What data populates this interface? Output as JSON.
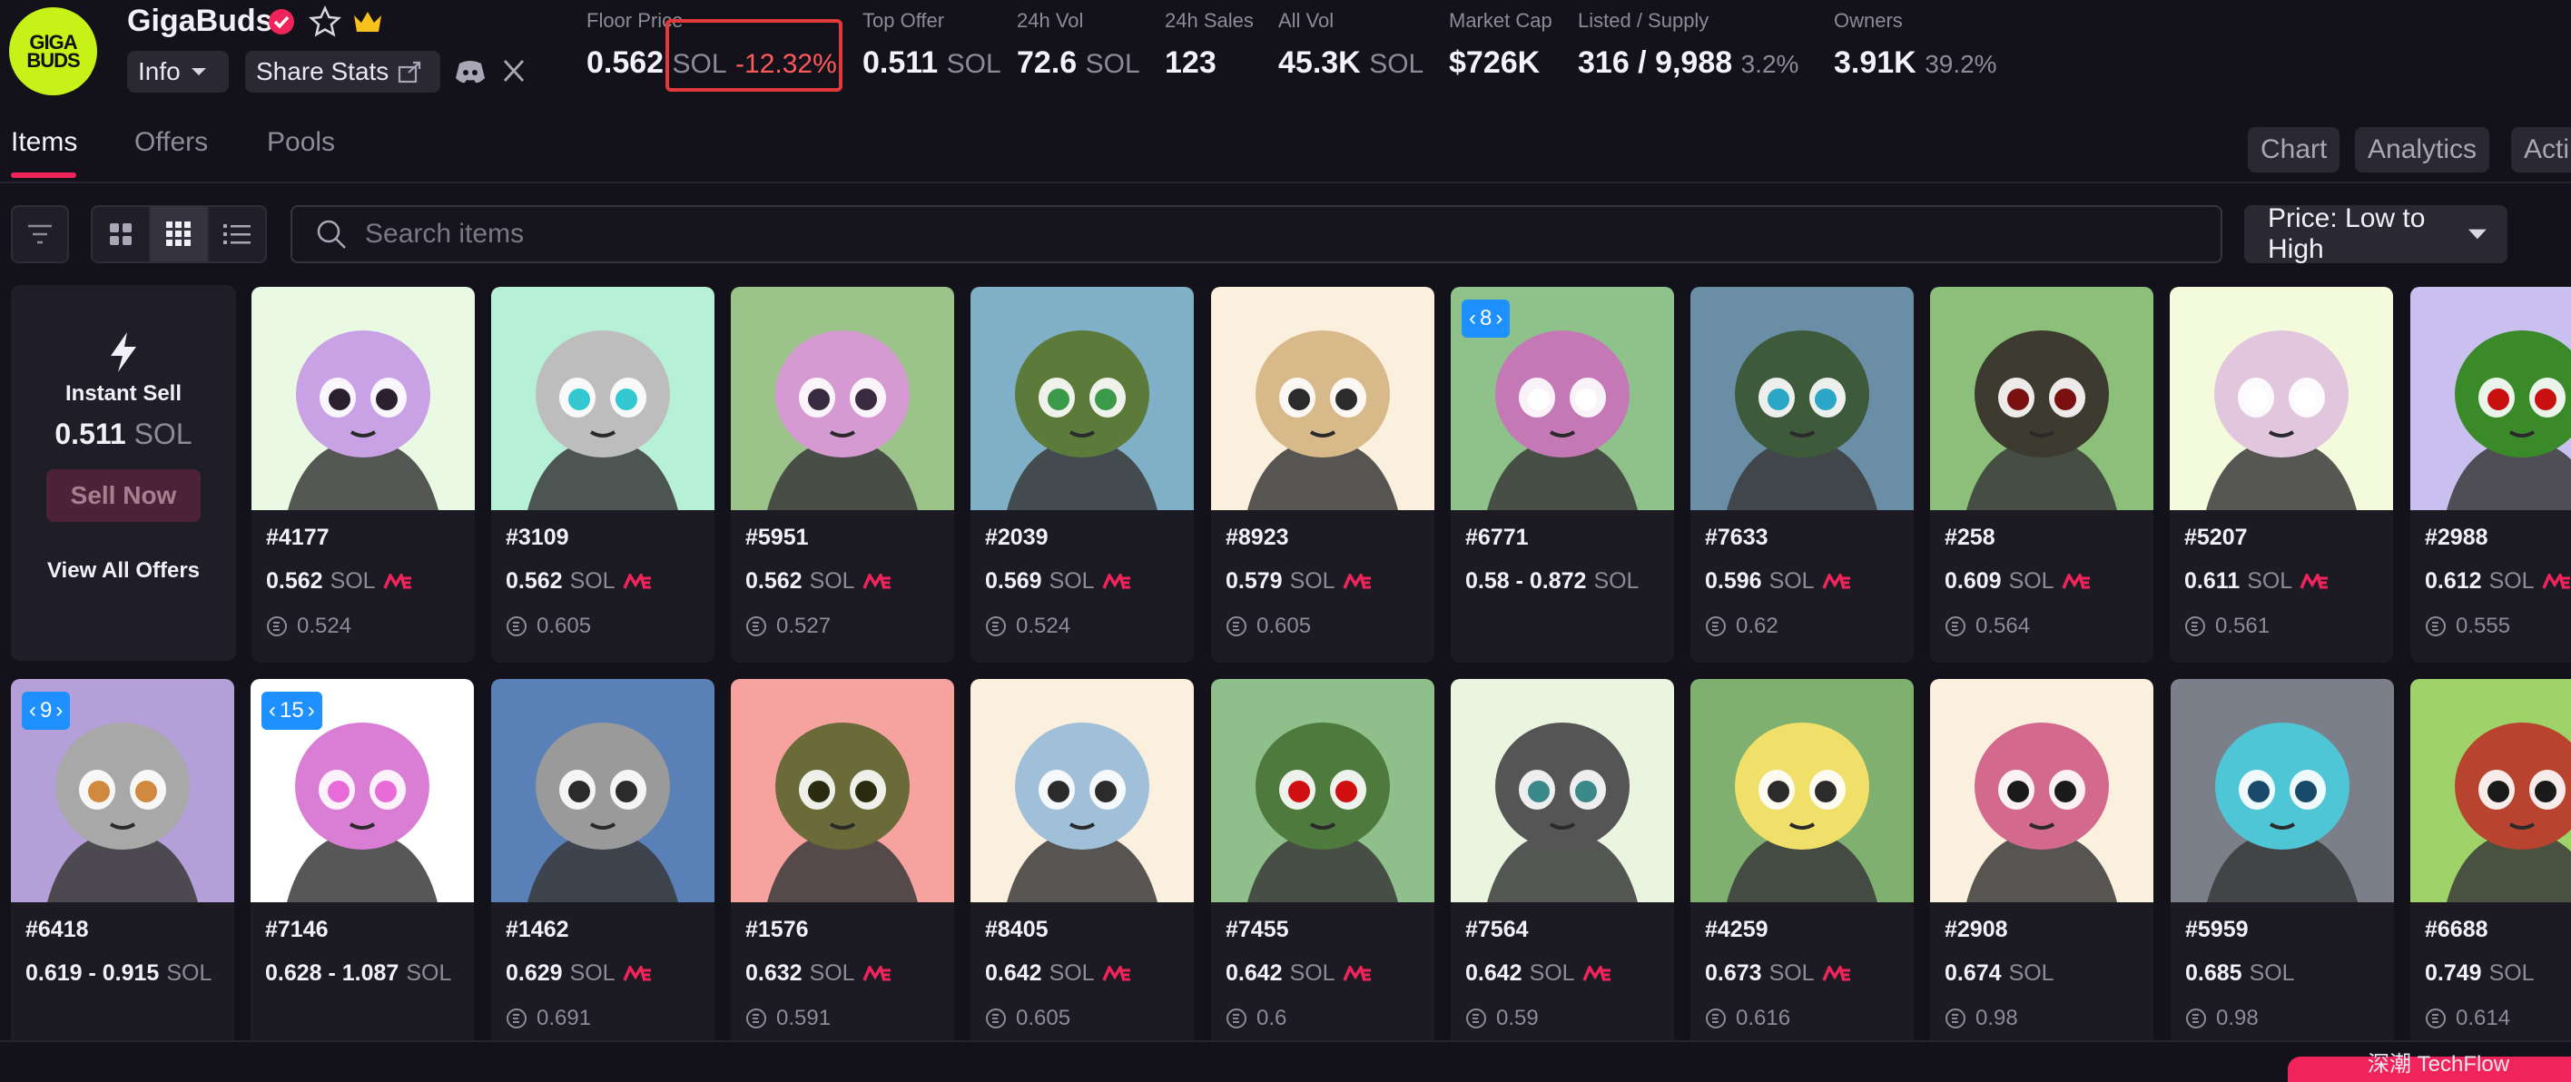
{
  "collection": {
    "name": "GigaBuds",
    "logo_text": "GIGA\nBUDS",
    "info_label": "Info",
    "share_label": "Share Stats"
  },
  "stats": [
    {
      "label": "Floor Price",
      "value": "0.562",
      "unit": "SOL",
      "change": "-12.32%"
    },
    {
      "label": "Top Offer",
      "value": "0.511",
      "unit": "SOL"
    },
    {
      "label": "24h Vol",
      "value": "72.6",
      "unit": "SOL"
    },
    {
      "label": "24h Sales",
      "value": "123"
    },
    {
      "label": "All Vol",
      "value": "45.3K",
      "unit": "SOL"
    },
    {
      "label": "Market Cap",
      "value": "$726K"
    },
    {
      "label": "Listed / Supply",
      "value": "316 / 9,988",
      "pct": "3.2%"
    },
    {
      "label": "Owners",
      "value": "3.91K",
      "pct": "39.2%"
    }
  ],
  "tabs": [
    {
      "label": "Items",
      "active": true
    },
    {
      "label": "Offers",
      "active": false
    },
    {
      "label": "Pools",
      "active": false
    }
  ],
  "right_tabs": [
    "Chart",
    "Analytics",
    "Acti"
  ],
  "search": {
    "placeholder": "Search items"
  },
  "sort": {
    "label": "Price: Low to High"
  },
  "instant_sell": {
    "title": "Instant Sell",
    "price": "0.511",
    "unit": "SOL",
    "button": "Sell Now",
    "link": "View All Offers"
  },
  "colors": {
    "accent": "#f0245b",
    "brand_logo": "#c6f218",
    "negative": "#ff5a5a",
    "badge": "#1e90ff"
  },
  "items": [
    {
      "id": "#4177",
      "price": "0.562",
      "unit": "SOL",
      "me": true,
      "last": "0.524",
      "badge": "",
      "bg": "#eaf9e4",
      "head": "#c9a2e6",
      "eye": "#2b2030"
    },
    {
      "id": "#3109",
      "price": "0.562",
      "unit": "SOL",
      "me": true,
      "last": "0.605",
      "badge": "",
      "bg": "#b6f0d6",
      "head": "#bdbdbd",
      "eye": "#33c7d1"
    },
    {
      "id": "#5951",
      "price": "0.562",
      "unit": "SOL",
      "me": true,
      "last": "0.527",
      "badge": "",
      "bg": "#9cc38a",
      "head": "#d49ad1",
      "eye": "#3a2b40"
    },
    {
      "id": "#2039",
      "price": "0.569",
      "unit": "SOL",
      "me": true,
      "last": "0.524",
      "badge": "",
      "bg": "#7fb0c8",
      "head": "#5c7a3a",
      "eye": "#3a9a4a"
    },
    {
      "id": "#8923",
      "price": "0.579",
      "unit": "SOL",
      "me": true,
      "last": "0.605",
      "badge": "",
      "bg": "#fbf0dd",
      "head": "#d8b98a",
      "eye": "#2b2b2b"
    },
    {
      "id": "#6771",
      "price": "0.58 - 0.872",
      "unit": "SOL",
      "me": false,
      "last": "",
      "badge": "8",
      "bg": "#8fc18a",
      "head": "#c479b6",
      "eye": "#ffffff"
    },
    {
      "id": "#7633",
      "price": "0.596",
      "unit": "SOL",
      "me": true,
      "last": "0.62",
      "badge": "",
      "bg": "#6a8ea6",
      "head": "#3d5a3a",
      "eye": "#2aa7c7"
    },
    {
      "id": "#258",
      "price": "0.609",
      "unit": "SOL",
      "me": true,
      "last": "0.564",
      "badge": "",
      "bg": "#8cbf7a",
      "head": "#3d3a30",
      "eye": "#7a1010"
    },
    {
      "id": "#5207",
      "price": "0.611",
      "unit": "SOL",
      "me": true,
      "last": "0.561",
      "badge": "",
      "bg": "#f4fbdc",
      "head": "#e2c6de",
      "eye": "#ffffff"
    },
    {
      "id": "#2988",
      "price": "0.612",
      "unit": "SOL",
      "me": true,
      "last": "0.555",
      "badge": "",
      "bg": "#c9c0f0",
      "head": "#3a8a2a",
      "eye": "#c81010"
    },
    {
      "id": "#6418",
      "price": "0.619 - 0.915",
      "unit": "SOL",
      "me": false,
      "last": "",
      "badge": "9",
      "bg": "#b59fd8",
      "head": "#a8a8a8",
      "eye": "#d08a40"
    },
    {
      "id": "#7146",
      "price": "0.628 - 1.087",
      "unit": "SOL",
      "me": false,
      "last": "",
      "badge": "15",
      "bg": "#ffffff",
      "head": "#d97ed4",
      "eye": "#e86bd9"
    },
    {
      "id": "#1462",
      "price": "0.629",
      "unit": "SOL",
      "me": true,
      "last": "0.691",
      "badge": "",
      "bg": "#5a80b8",
      "head": "#9a9a9a",
      "eye": "#2b2b2b"
    },
    {
      "id": "#1576",
      "price": "0.632",
      "unit": "SOL",
      "me": true,
      "last": "0.591",
      "badge": "",
      "bg": "#f6a3a0",
      "head": "#6b6b3a",
      "eye": "#2b2b10"
    },
    {
      "id": "#8405",
      "price": "0.642",
      "unit": "SOL",
      "me": true,
      "last": "0.605",
      "badge": "",
      "bg": "#fbf0dd",
      "head": "#9fc0d8",
      "eye": "#2b2b2b"
    },
    {
      "id": "#7455",
      "price": "0.642",
      "unit": "SOL",
      "me": true,
      "last": "0.6",
      "badge": "",
      "bg": "#8fbf8a",
      "head": "#4f7a3e",
      "eye": "#d01010"
    },
    {
      "id": "#7564",
      "price": "0.642",
      "unit": "SOL",
      "me": true,
      "last": "0.59",
      "badge": "",
      "bg": "#eaf5e0",
      "head": "#555555",
      "eye": "#3a8a8a"
    },
    {
      "id": "#4259",
      "price": "0.673",
      "unit": "SOL",
      "me": true,
      "last": "0.616",
      "badge": "",
      "bg": "#7fb070",
      "head": "#f0e06a",
      "eye": "#2b2b2b"
    },
    {
      "id": "#2908",
      "price": "0.674",
      "unit": "SOL",
      "me": false,
      "last": "0.98",
      "badge": "",
      "bg": "#fbf0dd",
      "head": "#d36a8e",
      "eye": "#1a1a1a"
    },
    {
      "id": "#5959",
      "price": "0.685",
      "unit": "SOL",
      "me": false,
      "last": "0.98",
      "badge": "",
      "bg": "#7a7f8a",
      "head": "#4fc6d6",
      "eye": "#1a4a6a"
    },
    {
      "id": "#6688",
      "price": "0.749",
      "unit": "SOL",
      "me": false,
      "last": "0.614",
      "badge": "",
      "bg": "#9fd36a",
      "head": "#b8432e",
      "eye": "#1a1a1a"
    }
  ],
  "watermark": "深潮 TechFlow"
}
